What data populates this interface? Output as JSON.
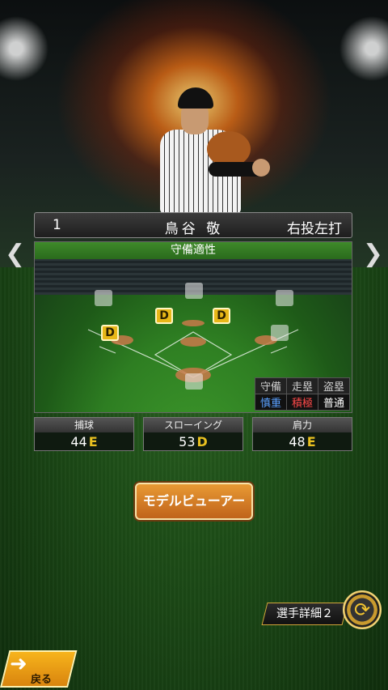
{
  "player": {
    "number": "1",
    "name": "鳥谷 敬",
    "throw_bat": "右投左打"
  },
  "nav": {
    "prev_icon": "chevron-left",
    "next_icon": "chevron-right",
    "prev_glyph": "❮",
    "next_glyph": "❯"
  },
  "defense": {
    "title": "守備適性",
    "positions": {
      "left_field": "",
      "center_field": "",
      "right_field": "",
      "third_base": "D",
      "shortstop": "D",
      "second_base": "D",
      "first_base": "",
      "catcher": ""
    },
    "attributes": {
      "headers": [
        "守備",
        "走塁",
        "盗塁"
      ],
      "values": [
        "慎重",
        "積極",
        "普通"
      ]
    }
  },
  "stats": [
    {
      "label": "捕球",
      "value": "44",
      "grade": "E"
    },
    {
      "label": "スローイング",
      "value": "53",
      "grade": "D"
    },
    {
      "label": "肩力",
      "value": "48",
      "grade": "E"
    }
  ],
  "buttons": {
    "model_viewer": "モデルビューアー",
    "player_detail": "選手詳細２",
    "back": "戻る",
    "swap_icon": "swap-arrows-icon"
  },
  "colors": {
    "grade_yellow": "#e8b718",
    "field_green": "#2e7e22",
    "accent_orange": "#e89a34",
    "value_blue": "#5aa0ff",
    "value_red": "#ff4a4a"
  }
}
